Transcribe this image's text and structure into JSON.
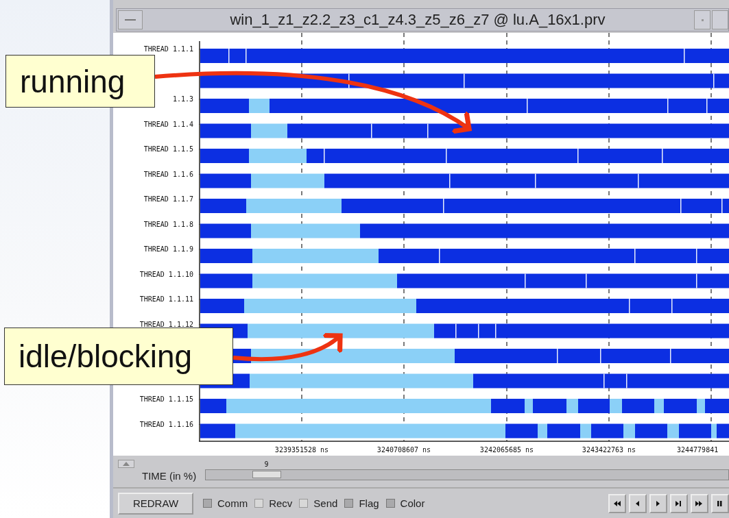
{
  "window": {
    "title": "win_1_z1_z2.2_z3_c1_z4.3_z5_z6_z7 @ lu.A_16x1.prv"
  },
  "timeline": {
    "rows": [
      {
        "label": "THREAD 1.1.1"
      },
      {},
      {
        "label": "1.1.3"
      },
      {
        "label": "THREAD 1.1.4"
      },
      {
        "label": "THREAD 1.1.5"
      },
      {
        "label": "THREAD 1.1.6"
      },
      {
        "label": "THREAD 1.1.7"
      },
      {
        "label": "THREAD 1.1.8"
      },
      {
        "label": "THREAD 1.1.9"
      },
      {
        "label": "THREAD 1.1.10"
      },
      {
        "label": "THREAD 1.1.11"
      },
      {
        "label": "THREAD 1.1.12"
      },
      {},
      {},
      {
        "label": "THREAD 1.1.15"
      },
      {
        "label": "THREAD 1.1.16"
      }
    ],
    "ticks": [
      "3239351528 ns",
      "3240708607 ns",
      "3242065685 ns",
      "3243422763 ns",
      "3244779841"
    ]
  },
  "time_slider": {
    "label": "TIME (in %)",
    "value": "9",
    "level": 0.09
  },
  "toolbar": {
    "redraw": "REDRAW",
    "options": [
      {
        "label": "Comm",
        "checked": true
      },
      {
        "label": "Recv",
        "checked": false
      },
      {
        "label": "Send",
        "checked": false
      },
      {
        "label": "Flag",
        "checked": true
      },
      {
        "label": "Color",
        "checked": true
      }
    ]
  },
  "callouts": [
    {
      "text": "running"
    },
    {
      "text": "idle/blocking"
    }
  ]
}
